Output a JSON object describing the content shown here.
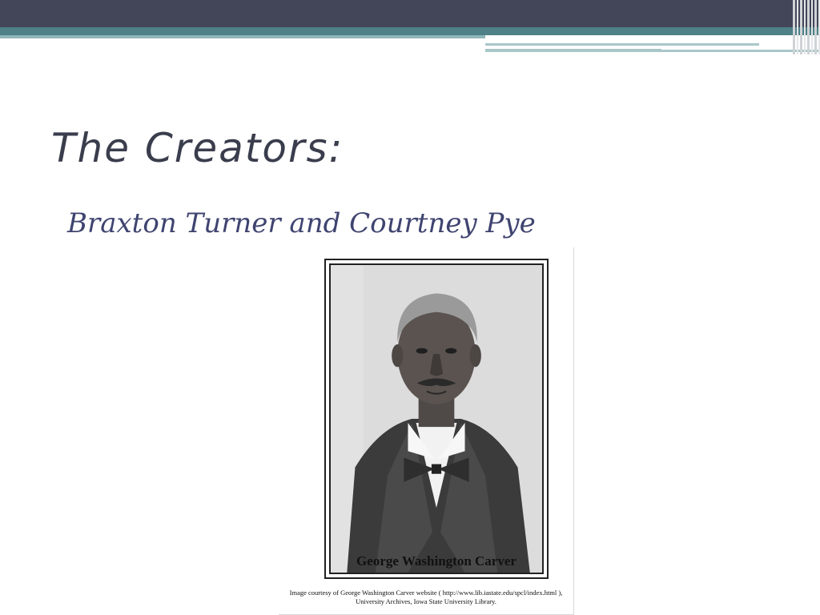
{
  "slide": {
    "title": "The Creators:",
    "subtitle": "Braxton Turner and Courtney Pye"
  },
  "image": {
    "caption": "George Washington Carver",
    "credit_line1": "Image courtesy of George Washington Carver website ( http://www.lib.iastate.edu/spcl/index.html ),",
    "credit_line2": "University Archives, Iowa State University Library."
  },
  "colors": {
    "header_dark": "#434658",
    "header_teal": "#4d8087",
    "title_text": "#3a3d4c",
    "subtitle_text": "#3f4470"
  }
}
